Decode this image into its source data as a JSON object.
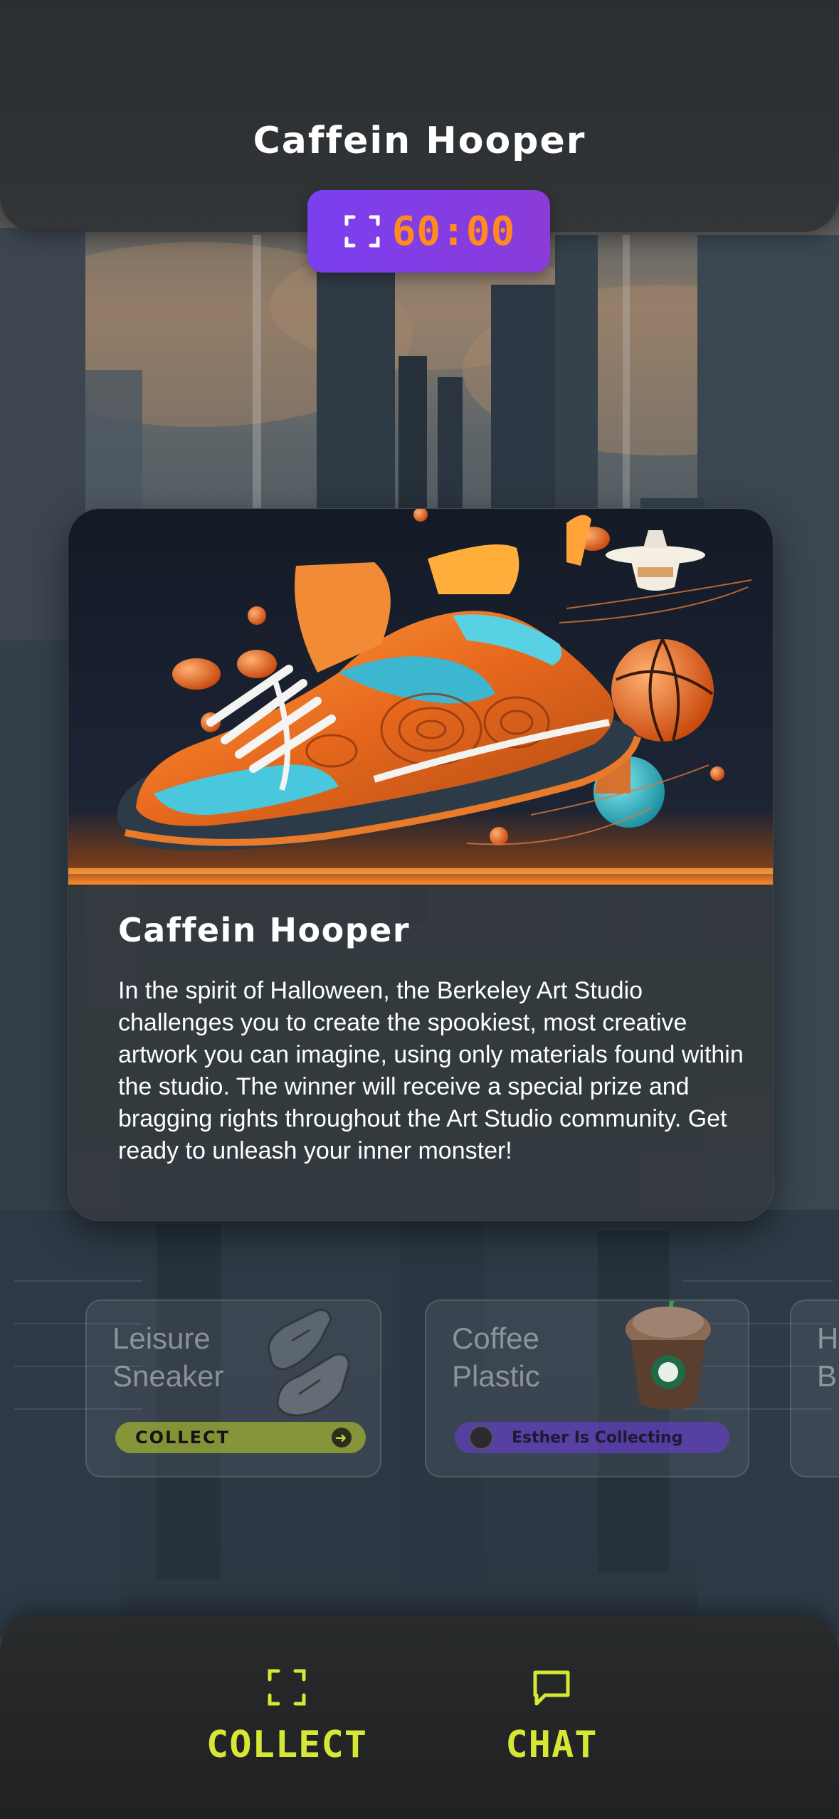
{
  "header": {
    "title": "Caffein Hooper",
    "timer": "60:00"
  },
  "card": {
    "title": "Caffein Hooper",
    "description": "In the spirit of Halloween, the Berkeley Art Studio challenges you to create the spookiest, most creative artwork you can imagine, using only materials found within the studio.  The winner will receive a special prize and bragging rights throughout the Art Studio community.  Get ready to unleash your inner monster!"
  },
  "items": [
    {
      "title_line1": "Leisure",
      "title_line2": "Sneaker",
      "action": "COLLECT"
    },
    {
      "title_line1": "Coffee",
      "title_line2": "Plastic",
      "status": "Esther Is Collecting"
    },
    {
      "title_line1": "H",
      "title_line2": "B"
    }
  ],
  "nav": {
    "collect": "COLLECT",
    "chat": "CHAT"
  },
  "colors": {
    "accent_lime": "#d6e833",
    "timer_bg": "#7b3ff0",
    "timer_text": "#ff8a1f"
  },
  "icons": {
    "timer": "scan-frame-icon",
    "collect": "scan-frame-icon",
    "chat": "chat-bubble-icon"
  }
}
